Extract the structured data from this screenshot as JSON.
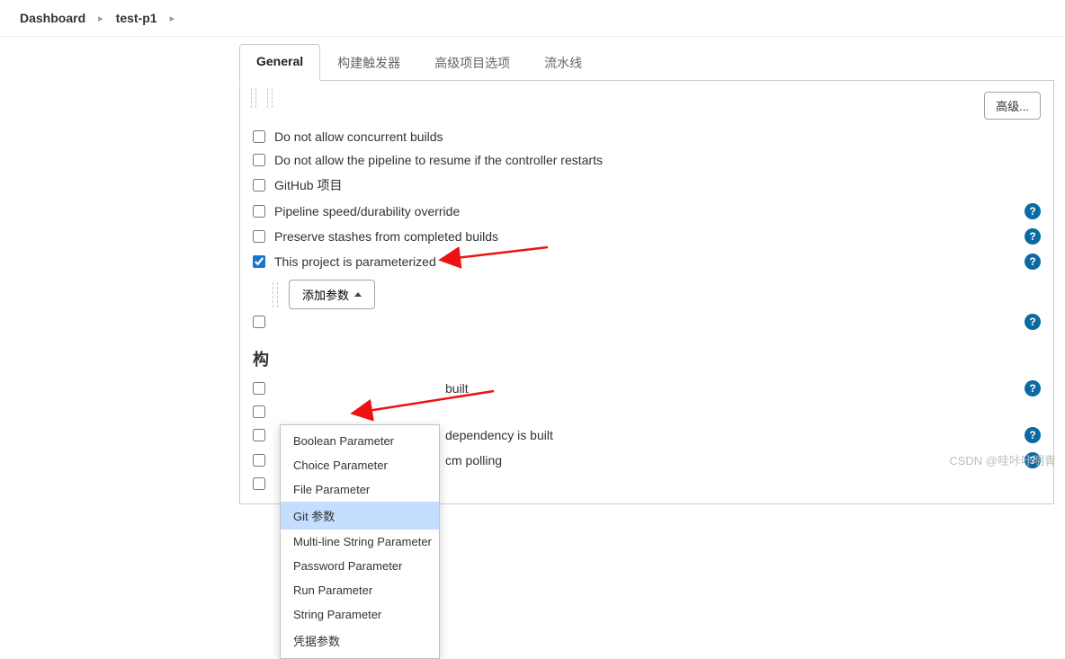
{
  "breadcrumb": {
    "root": "Dashboard",
    "project": "test-p1"
  },
  "tabs": {
    "general": "General",
    "triggers": "构建触发器",
    "advancedProj": "高级项目选项",
    "pipeline": "流水线"
  },
  "buttons": {
    "advanced": "高级...",
    "addParam": "添加参数"
  },
  "options": {
    "noConcurrent": "Do not allow concurrent builds",
    "noResume": "Do not allow the pipeline to resume if the controller restarts",
    "githubProj": "GitHub 项目",
    "speedOverride": "Pipeline speed/durability override",
    "preserveStash": "Preserve stashes from completed builds",
    "parameterized": "This project is parameterized"
  },
  "dropdown": {
    "boolean": "Boolean Parameter",
    "choice": "Choice Parameter",
    "file": "File Parameter",
    "git": "Git 参数",
    "multiline": "Multi-line String Parameter",
    "password": "Password Parameter",
    "run": "Run Parameter",
    "string": "String Parameter",
    "credentials": "凭据参数"
  },
  "section": {
    "buildTrigHeader": "构"
  },
  "behind": {
    "built": "built",
    "depBuilt": "dependency is built",
    "scmPolling": "cm polling"
  },
  "help_icon": "?",
  "watermark": "CSDN @哇咔咔明青"
}
